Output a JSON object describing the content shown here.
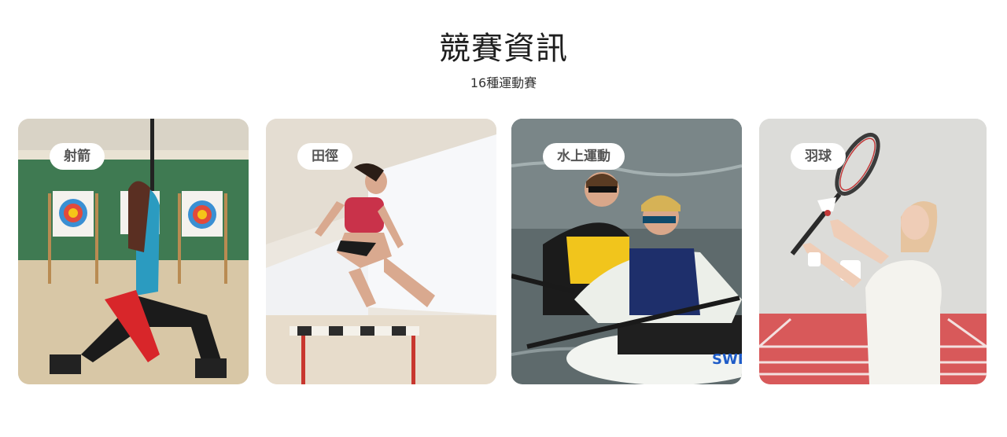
{
  "section": {
    "title": "競賽資訊",
    "subtitle": "16種運動賽"
  },
  "cards": [
    {
      "label": "射箭",
      "image": "archery-photo"
    },
    {
      "label": "田徑",
      "image": "athletics-hurdle-photo"
    },
    {
      "label": "水上運動",
      "image": "kayak-photo"
    },
    {
      "label": "羽球",
      "image": "badminton-photo"
    }
  ],
  "colors": {
    "accent_green_wall": "#3f7a52",
    "track_red": "#d8595a",
    "pill_bg": "#ffffff"
  }
}
